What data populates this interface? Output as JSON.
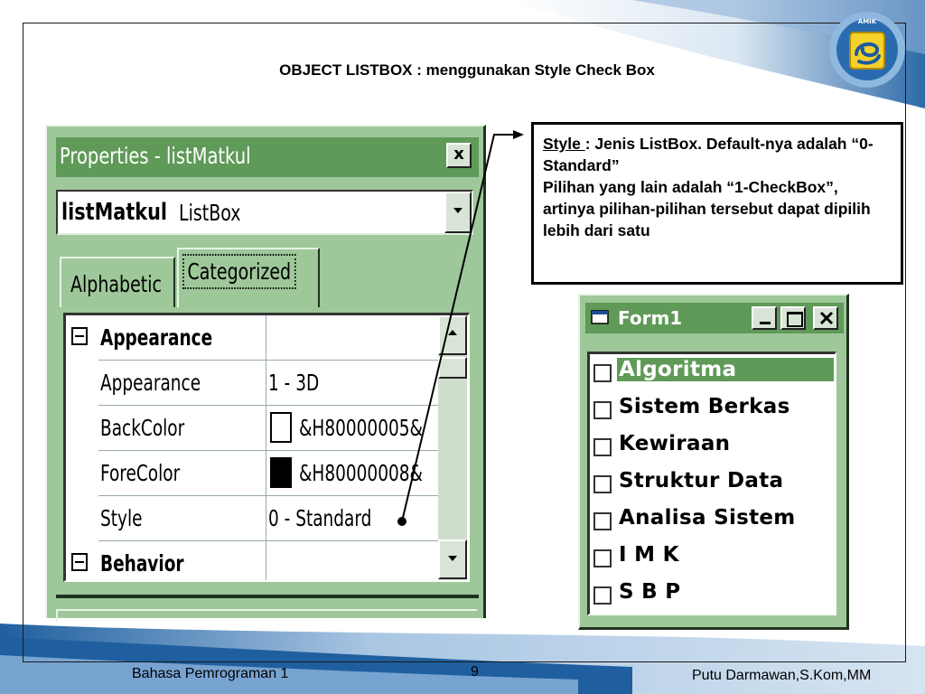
{
  "slide": {
    "title": "OBJECT LISTBOX : menggunakan Style Check Box",
    "footer_left": "Bahasa Pemrograman 1",
    "page_number": "9",
    "footer_right": "Putu Darmawan,S.Kom,MM",
    "logo_text": "AMIK"
  },
  "properties_window": {
    "title": "Properties - listMatkul",
    "close_label": "x",
    "object_name": "listMatkul",
    "object_type": "ListBox",
    "tabs": [
      {
        "label": "Alphabetic",
        "active": false
      },
      {
        "label": "Categorized",
        "active": true
      }
    ],
    "rows": [
      {
        "kind": "category",
        "name": "Appearance",
        "value": ""
      },
      {
        "kind": "property",
        "name": "Appearance",
        "value": "1 - 3D"
      },
      {
        "kind": "property",
        "name": "BackColor",
        "value": "&H80000005&",
        "swatch": "#ffffff"
      },
      {
        "kind": "property",
        "name": "ForeColor",
        "value": "&H80000008&",
        "swatch": "#000000"
      },
      {
        "kind": "property",
        "name": "Style",
        "value": "0 - Standard"
      },
      {
        "kind": "category",
        "name": "Behavior",
        "value": ""
      }
    ]
  },
  "callout": {
    "term": "Style ",
    "line1_rest": ": Jenis ListBox. Default-nya adalah “0-Standard”",
    "line2": "Pilihan yang lain adalah “1-CheckBox”, artinya pilihan-pilihan tersebut dapat dipilih lebih dari satu"
  },
  "form_window": {
    "title": "Form1",
    "items": [
      {
        "label": "Algoritma",
        "selected": true
      },
      {
        "label": "Sistem Berkas",
        "selected": false
      },
      {
        "label": "Kewiraan",
        "selected": false
      },
      {
        "label": "Struktur Data",
        "selected": false
      },
      {
        "label": "Analisa Sistem",
        "selected": false
      },
      {
        "label": "I M K",
        "selected": false
      },
      {
        "label": "S B P",
        "selected": false
      }
    ]
  },
  "colors": {
    "window_face": "#9ec79a",
    "titlebar": "#5f9a58",
    "slide_band": "#1f5f9f"
  }
}
